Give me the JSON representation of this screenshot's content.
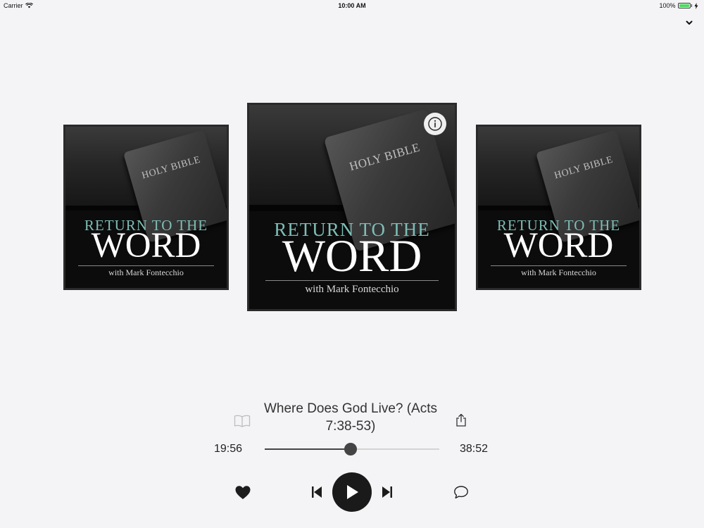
{
  "status_bar": {
    "carrier": "Carrier",
    "time": "10:00 AM",
    "battery": "100%",
    "battery_level": 1.0
  },
  "artwork": {
    "bible_text": "HOLY BIBLE",
    "title_line1": "RETURN TO THE",
    "title_line2": "WORD",
    "subtitle": "with Mark Fontecchio"
  },
  "episode": {
    "title": "Where Does God Live? (Acts 7:38-53)"
  },
  "progress": {
    "elapsed": "19:56",
    "total": "38:52",
    "fraction": 0.49
  },
  "icons": {
    "collapse": "chevron-down-icon",
    "info": "info-icon",
    "book": "book-icon",
    "share": "share-icon",
    "favorite": "heart-icon",
    "previous": "skip-back-icon",
    "play": "play-icon",
    "next": "skip-forward-icon",
    "comment": "comment-icon"
  },
  "colors": {
    "background": "#f4f3f6",
    "accent_dark": "#1a1a1a",
    "title_teal": "#7dbdb6",
    "battery_green": "#4cd964"
  }
}
